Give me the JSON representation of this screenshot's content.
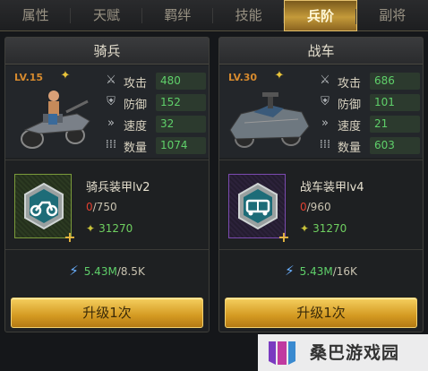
{
  "tabs": [
    {
      "label": "属性"
    },
    {
      "label": "天赋"
    },
    {
      "label": "羁绊"
    },
    {
      "label": "技能"
    },
    {
      "label": "兵阶",
      "active": true
    },
    {
      "label": "副将"
    }
  ],
  "units": [
    {
      "title": "骑兵",
      "level": "LV.15",
      "stats": [
        {
          "icon": "swords-icon",
          "label": "攻击",
          "value": "480"
        },
        {
          "icon": "shield-icon",
          "label": "防御",
          "value": "152"
        },
        {
          "icon": "speed-icon",
          "label": "速度",
          "value": "32"
        },
        {
          "icon": "troops-icon",
          "label": "数量",
          "value": "1074"
        }
      ],
      "armor": {
        "name": "骑兵装甲lv2",
        "progress_current": "0",
        "progress_total": "/750",
        "cost": "31270",
        "icon": "motorcycle-icon"
      },
      "resource": {
        "current": "5.43M",
        "required": "/8.5K"
      },
      "upgrade_label": "升级1次"
    },
    {
      "title": "战车",
      "level": "LV.30",
      "stats": [
        {
          "icon": "swords-icon",
          "label": "攻击",
          "value": "686"
        },
        {
          "icon": "shield-icon",
          "label": "防御",
          "value": "101"
        },
        {
          "icon": "speed-icon",
          "label": "速度",
          "value": "21"
        },
        {
          "icon": "troops-icon",
          "label": "数量",
          "value": "603"
        }
      ],
      "armor": {
        "name": "战车装甲lv4",
        "progress_current": "0",
        "progress_total": "/960",
        "cost": "31270",
        "icon": "truck-icon"
      },
      "resource": {
        "current": "5.43M",
        "required": "/16K"
      },
      "upgrade_label": "升级1次"
    }
  ],
  "watermark": {
    "text": "桑巴游戏园"
  },
  "colors": {
    "accent_gold": "#d49a22",
    "stat_green": "#5fd06a",
    "level_orange": "#d68a2e",
    "progress_red": "#e04030",
    "armor_green_border": "#7a9a3a",
    "armor_purple_border": "#7b4ab0"
  }
}
